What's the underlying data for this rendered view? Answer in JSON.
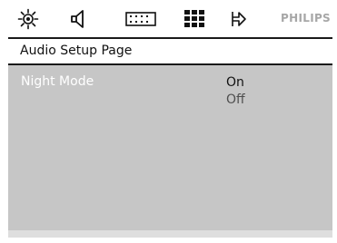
{
  "icons": [
    {
      "name": "general-setup-icon"
    },
    {
      "name": "audio-setup-icon"
    },
    {
      "name": "video-setup-icon"
    },
    {
      "name": "preference-setup-icon"
    },
    {
      "name": "exit-icon"
    }
  ],
  "brand": "PHILIPS",
  "page_title": "Audio Setup Page",
  "setting": {
    "label": "Night Mode",
    "options": [
      "On",
      "Off"
    ],
    "highlighted_option": "On"
  },
  "colors": {
    "content_background": "#c6c6c6",
    "brand_text": "#a7a7a7"
  }
}
